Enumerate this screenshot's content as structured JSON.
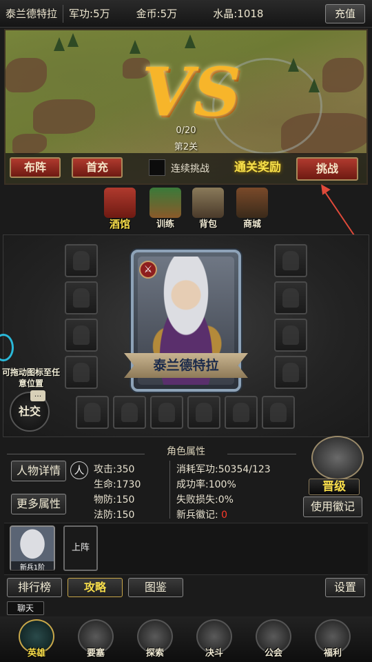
{
  "topbar": {
    "player_name": "泰兰德特拉",
    "military": "军功:5万",
    "gold": "金币:5万",
    "crystal": "水晶:1018",
    "recharge_label": "充值"
  },
  "battle": {
    "vs_text": "VS",
    "progress": "0/20",
    "stage": "第2关",
    "formation_label": "布阵",
    "first_recharge_label": "首充",
    "auto_challenge_label": "连续挑战",
    "clear_reward_label": "通关奖励",
    "challenge_label": "挑战"
  },
  "nav_icons": [
    {
      "label": "酒馆",
      "icon": "tavern-icon"
    },
    {
      "label": "训练",
      "icon": "training-icon"
    },
    {
      "label": "背包",
      "icon": "backpack-icon"
    },
    {
      "label": "商城",
      "icon": "shop-icon"
    }
  ],
  "hero": {
    "name": "泰兰德特拉",
    "drag_hint": "可拖动图标至任意位置",
    "social_label": "社交",
    "social_badge": "..."
  },
  "attributes": {
    "title": "角色属性",
    "detail_button": "人物详情",
    "person_char": "人",
    "more_button": "更多属性",
    "attack": "攻击:350",
    "hp": "生命:1730",
    "phys_def": "物防:150",
    "magic_def": "法防:150",
    "cost": "消耗军功:50354/123",
    "success_rate": "成功率:100%",
    "fail_loss": "失败损失:0%",
    "recruit_badge_label": "新兵徽记:",
    "recruit_badge_value": "0",
    "promote_label": "晋级",
    "use_badge_label": "使用徽记"
  },
  "lineup": {
    "hero_thumb_label": "新兵1阶",
    "deploy_label": "上阵"
  },
  "menu_row": {
    "ranking": "排行榜",
    "strategy": "攻略",
    "gallery": "图鉴",
    "settings": "设置"
  },
  "chat_label": "聊天",
  "bottom_nav": [
    {
      "label": "英雄",
      "icon": "hero-helmet-icon",
      "active": true
    },
    {
      "label": "要塞",
      "icon": "fortress-icon",
      "active": false
    },
    {
      "label": "探索",
      "icon": "explore-icon",
      "active": false
    },
    {
      "label": "决斗",
      "icon": "duel-swords-icon",
      "active": false
    },
    {
      "label": "公会",
      "icon": "guild-lion-icon",
      "active": false
    },
    {
      "label": "福利",
      "icon": "welfare-icon",
      "active": false
    }
  ],
  "colors": {
    "accent_gold": "#f7dd4a",
    "button_red": "#b03a2e",
    "highlight_red": "#ff3a2a",
    "annotation_arrow": "#e04a3a"
  }
}
